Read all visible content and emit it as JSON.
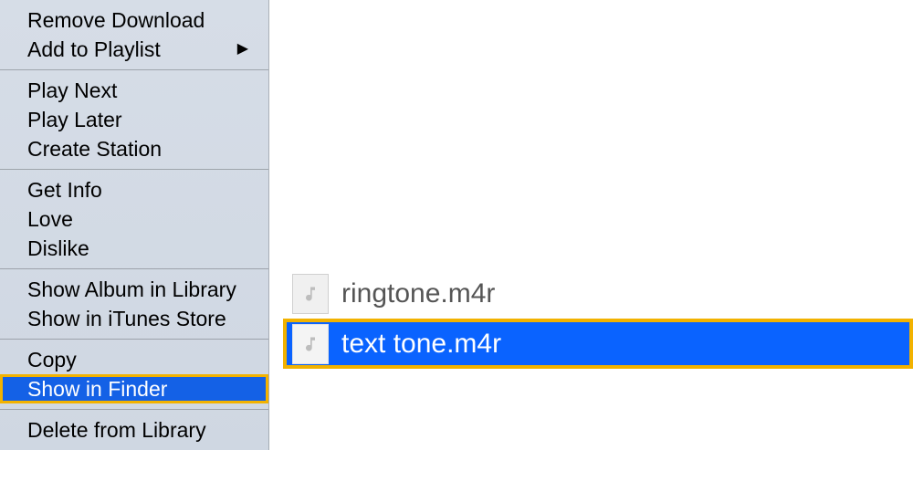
{
  "context_menu": {
    "groups": [
      [
        {
          "key": "remove-download",
          "label": "Remove Download",
          "submenu": false
        },
        {
          "key": "add-to-playlist",
          "label": "Add to Playlist",
          "submenu": true
        }
      ],
      [
        {
          "key": "play-next",
          "label": "Play Next",
          "submenu": false
        },
        {
          "key": "play-later",
          "label": "Play Later",
          "submenu": false
        },
        {
          "key": "create-station",
          "label": "Create Station",
          "submenu": false
        }
      ],
      [
        {
          "key": "get-info",
          "label": "Get Info",
          "submenu": false
        },
        {
          "key": "love",
          "label": "Love",
          "submenu": false
        },
        {
          "key": "dislike",
          "label": "Dislike",
          "submenu": false
        }
      ],
      [
        {
          "key": "show-album-in-library",
          "label": "Show Album in Library",
          "submenu": false
        },
        {
          "key": "show-in-itunes-store",
          "label": "Show in iTunes Store",
          "submenu": false
        }
      ],
      [
        {
          "key": "copy",
          "label": "Copy",
          "submenu": false
        },
        {
          "key": "show-in-finder",
          "label": "Show in Finder",
          "submenu": false,
          "selected": true,
          "highlight": true
        }
      ],
      [
        {
          "key": "delete-from-library",
          "label": "Delete from Library",
          "submenu": false
        }
      ]
    ]
  },
  "files": [
    {
      "name": "ringtone.m4r",
      "selected": false,
      "highlight": false
    },
    {
      "name": "text tone.m4r",
      "selected": true,
      "highlight": true
    }
  ],
  "colors": {
    "selection_blue": "#0a63ff",
    "menu_selection_blue": "#1461e6",
    "highlight_ring": "#f2b200"
  }
}
